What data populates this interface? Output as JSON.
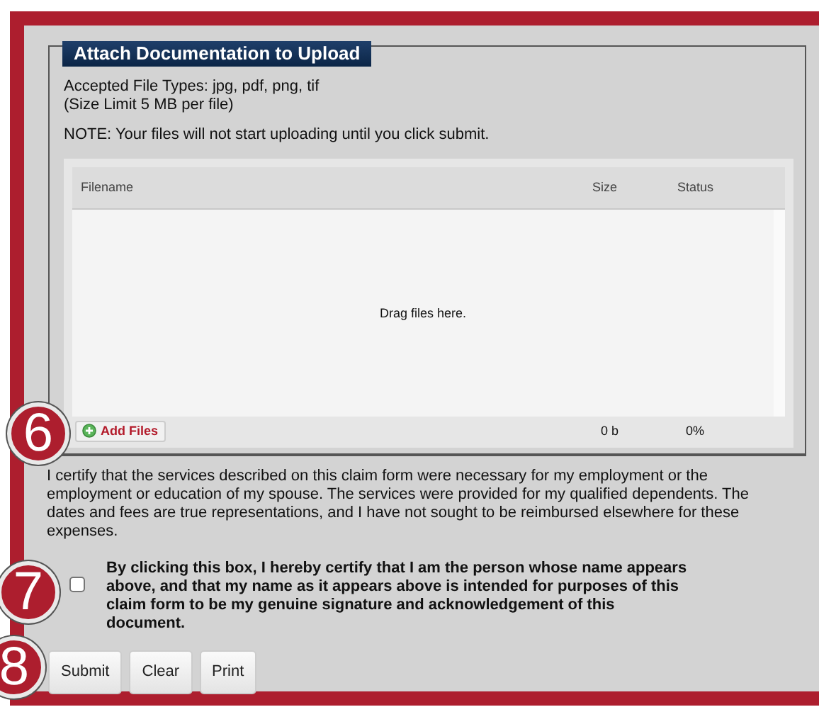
{
  "upload_section": {
    "legend": "Attach Documentation to Upload",
    "accepted_types": "Accepted File Types: jpg, pdf, png, tif",
    "size_limit": "(Size Limit 5 MB per file)",
    "note": "NOTE: Your files will not start uploading until you click submit.",
    "uploader": {
      "columns": [
        "Filename",
        "Size",
        "Status"
      ],
      "empty_message": "Drag files here.",
      "add_button": "Add Files",
      "total_size": "0 b",
      "total_status": "0%"
    }
  },
  "certification": "I certify that the services described on this claim form were necessary for my employment or the employment or education of my spouse. The services were provided for my qualified dependents. The dates and fees are true representations, and I have not sought to be reimbursed elsewhere for these expenses.",
  "signature": {
    "label": "By clicking this box, I hereby certify that I am the person whose name appears above, and that my name as it appears above is intended for purposes of this claim form to be my genuine signature and acknowledgement of this document.",
    "checked": false
  },
  "buttons": [
    "Submit",
    "Clear",
    "Print"
  ],
  "step_badges": [
    "6",
    "7",
    "8"
  ]
}
